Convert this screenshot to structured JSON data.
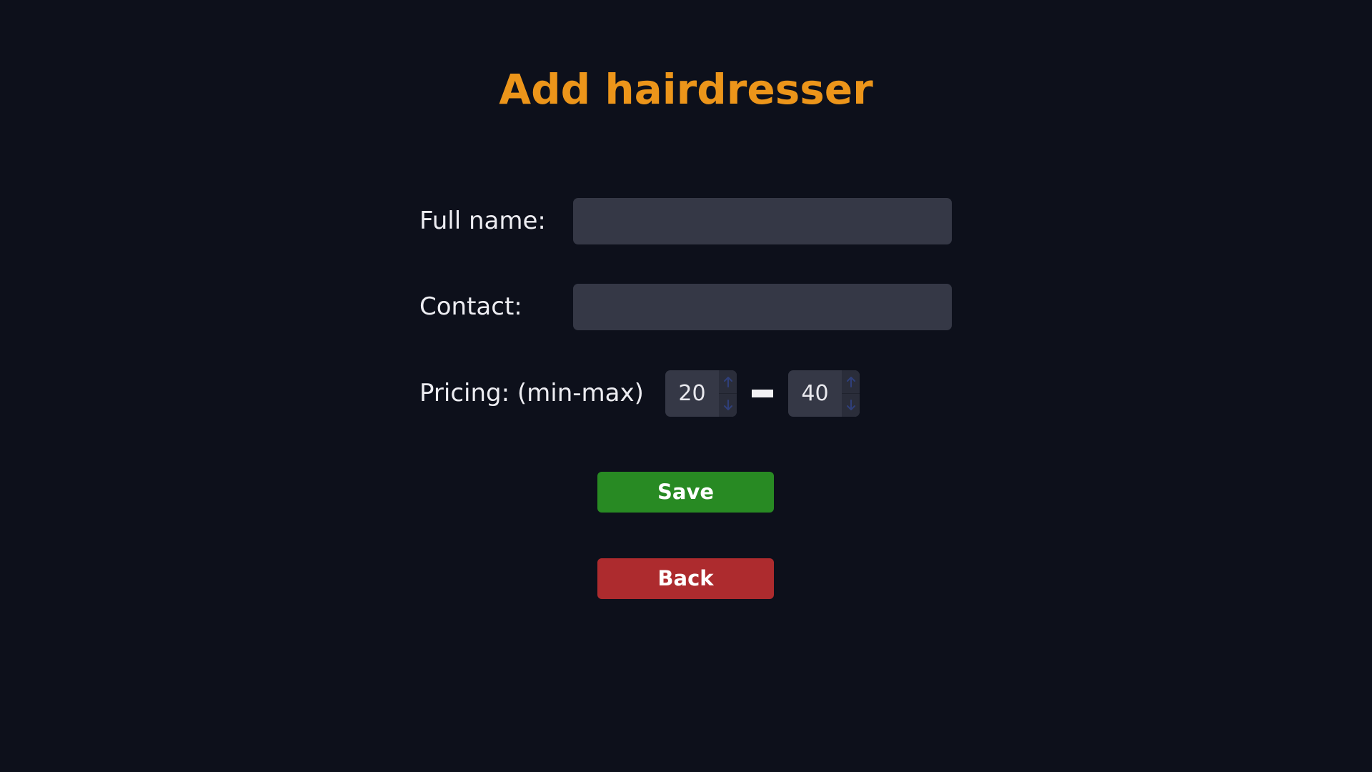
{
  "page": {
    "title": "Add hairdresser"
  },
  "form": {
    "full_name": {
      "label": "Full name:",
      "value": "",
      "placeholder": ""
    },
    "contact": {
      "label": "Contact:",
      "value": "",
      "placeholder": ""
    },
    "pricing": {
      "label": "Pricing: (min-max)",
      "min": "20",
      "max": "40"
    }
  },
  "actions": {
    "save_label": "Save",
    "back_label": "Back"
  },
  "icons": {
    "step_up": "arrow-up-icon",
    "step_down": "arrow-down-icon"
  },
  "colors": {
    "background": "#0d101b",
    "title": "#ec951a",
    "input_bg": "#353846",
    "save_button": "#288a23",
    "back_button": "#ad2b2e",
    "stepper_arrow": "#2f3f7a"
  }
}
